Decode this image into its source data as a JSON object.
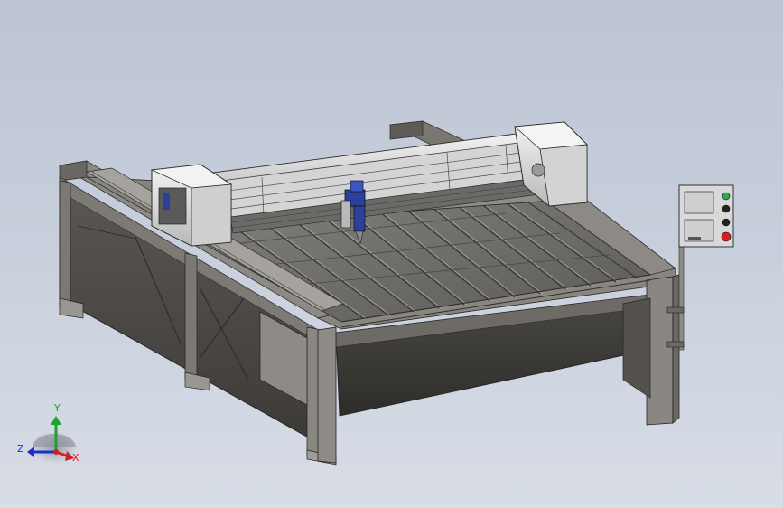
{
  "triad": {
    "x_label": "X",
    "y_label": "Y",
    "z_label": "Z",
    "x_color": "#d42020",
    "y_color": "#1ea032",
    "z_color": "#1f2fc8"
  },
  "model": {
    "frame_color": "#5f5b55",
    "bed_color": "#6e6b66",
    "gantry_color": "#e8e8e8",
    "torch_color": "#2b3f9c"
  },
  "control_panel": {
    "button_colors": [
      "#2fa84a",
      "#222222",
      "#222222",
      "#d42020"
    ]
  }
}
